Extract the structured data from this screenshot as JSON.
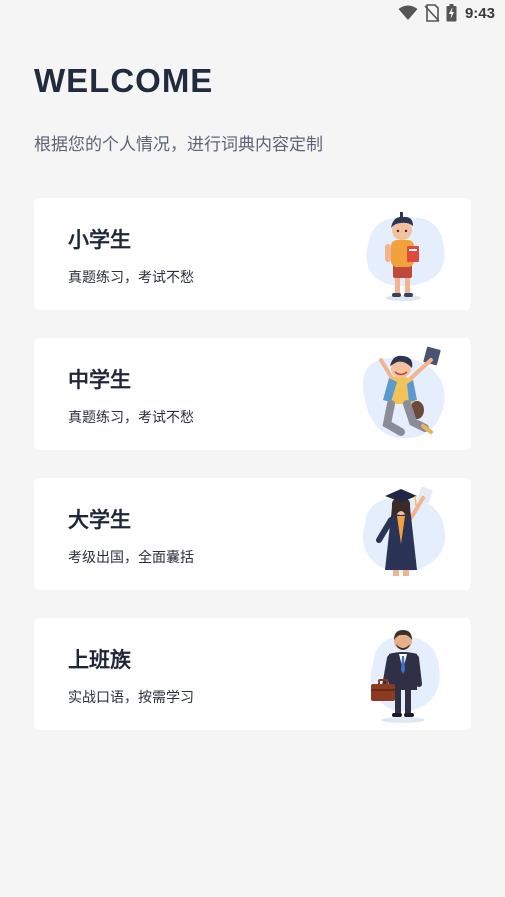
{
  "status_bar": {
    "time": "9:43",
    "icons": [
      "wifi-icon",
      "no-sim-icon",
      "battery-charging-icon"
    ]
  },
  "header": {
    "title": "WELCOME",
    "subtitle": "根据您的个人情况，进行词典内容定制"
  },
  "options": [
    {
      "title": "小学生",
      "desc": "真题练习，考试不愁",
      "icon": "schoolboy-illustration"
    },
    {
      "title": "中学生",
      "desc": "真题练习，考试不愁",
      "icon": "jumping-student-illustration"
    },
    {
      "title": "大学生",
      "desc": "考级出国，全面囊括",
      "icon": "graduate-illustration"
    },
    {
      "title": "上班族",
      "desc": "实战口语，按需学习",
      "icon": "office-worker-illustration"
    }
  ],
  "colors": {
    "background": "#f5f5f6",
    "card": "#ffffff",
    "title": "#222b3d",
    "accent_blob": "#e4eefc"
  }
}
